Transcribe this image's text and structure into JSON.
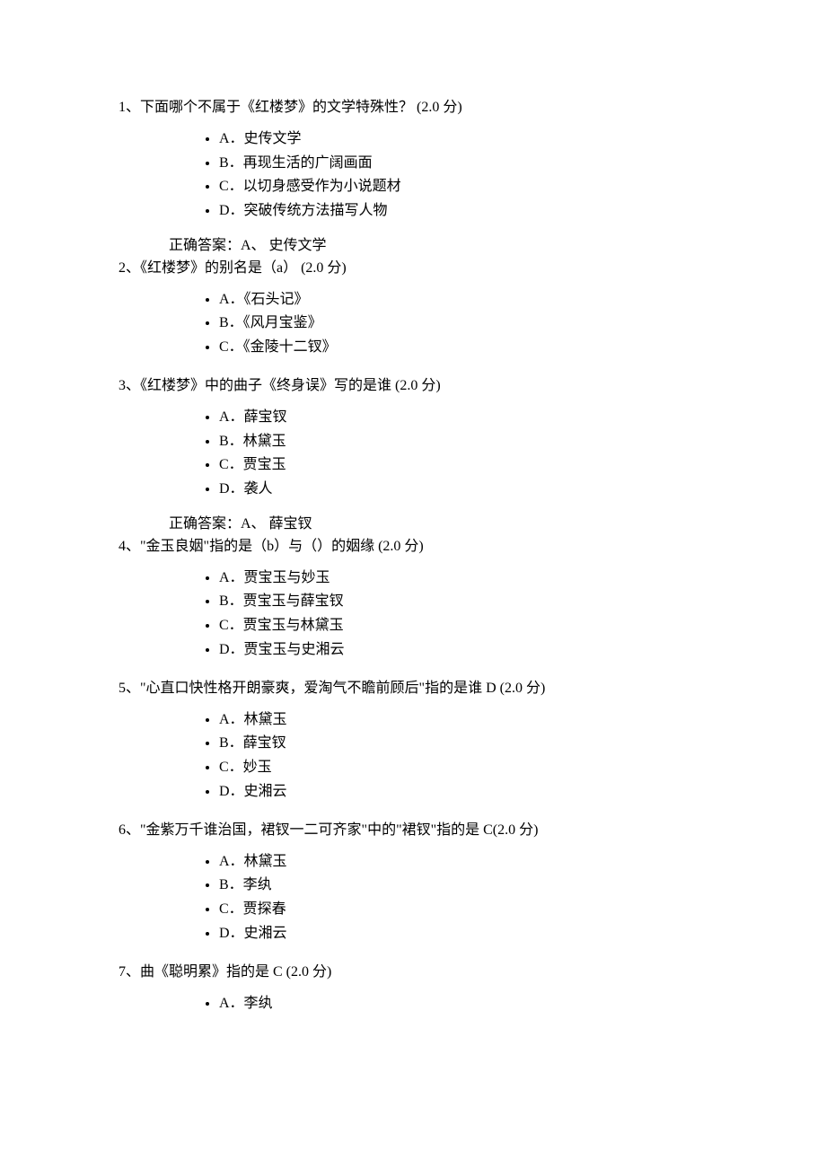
{
  "questions": [
    {
      "stem": "1、下面哪个不属于《红楼梦》的文学特殊性？   (2.0 分)",
      "options": [
        "A．史传文学",
        "B．再现生活的广阔画面",
        "C．以切身感受作为小说题材",
        "D．突破传统方法描写人物"
      ],
      "answer": "正确答案：A、  史传文学"
    },
    {
      "stem": "2、《红楼梦》的别名是（a）   (2.0 分)",
      "options": [
        "A．《石头记》",
        "B．《风月宝鉴》",
        "C．《金陵十二钗》"
      ],
      "answer": null
    },
    {
      "stem": "3、《红楼梦》中的曲子《终身误》写的是谁   (2.0 分)",
      "options": [
        "A．薛宝钗",
        "B．林黛玉",
        "C．贾宝玉",
        "D．袭人"
      ],
      "answer": "正确答案：A、  薛宝钗"
    },
    {
      "stem": "4、\"金玉良姻\"指的是（b）与（）的姻缘   (2.0 分)",
      "options": [
        "A．贾宝玉与妙玉",
        "B．贾宝玉与薛宝钗",
        "C．贾宝玉与林黛玉",
        "D．贾宝玉与史湘云"
      ],
      "answer": null
    },
    {
      "stem": "5、\"心直口快性格开朗豪爽，爱淘气不瞻前顾后\"指的是谁 D   (2.0 分)",
      "options": [
        "A．林黛玉",
        "B．薛宝钗",
        "C．妙玉",
        "D．史湘云"
      ],
      "answer": null
    },
    {
      "stem": "6、\"金紫万千谁治国，裙钗一二可齐家\"中的\"裙钗\"指的是   C(2.0 分)",
      "options": [
        "A．林黛玉",
        "B．李纨",
        "C．贾探春",
        "D．史湘云"
      ],
      "answer": null
    },
    {
      "stem": "7、曲《聪明累》指的是 C   (2.0 分)",
      "options": [
        "A．李纨"
      ],
      "answer": null
    }
  ]
}
